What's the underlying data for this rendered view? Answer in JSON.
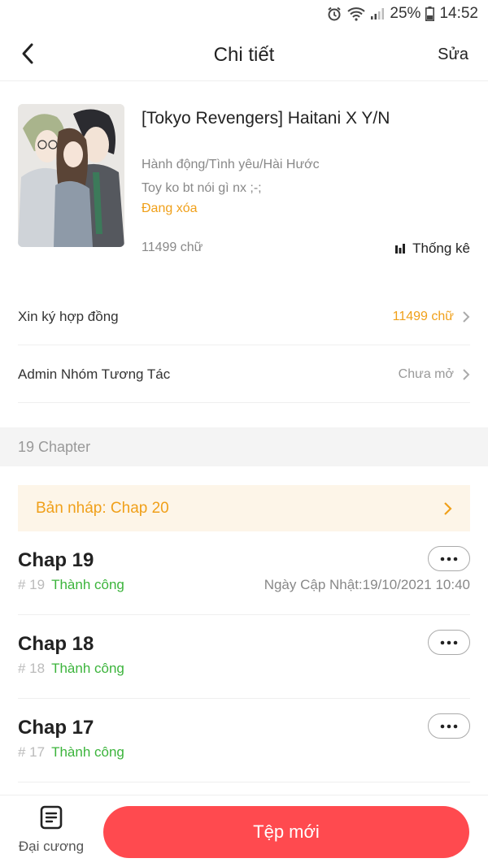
{
  "status_bar": {
    "battery": "25%",
    "time": "14:52"
  },
  "header": {
    "title": "Chi tiết",
    "edit_label": "Sửa"
  },
  "book": {
    "title": "[Tokyo Revengers] Haitani X Y/N",
    "genres": "Hành động/Tình yêu/Hài Hước",
    "description": "Toy ko bt nói gì nx ;-;",
    "status": "Đang xóa",
    "word_count": "11499 chữ",
    "stats_label": "Thống kê"
  },
  "rows": [
    {
      "label": "Xin ký hợp đồng",
      "value": "11499 chữ",
      "accent": true
    },
    {
      "label": "Admin Nhóm Tương Tác",
      "value": "Chưa mở",
      "accent": false
    }
  ],
  "chapter_section": {
    "title": "19 Chapter"
  },
  "draft": {
    "label": "Bản nháp: Chap 20"
  },
  "chapters": [
    {
      "title": "Chap 19",
      "num": "# 19",
      "status": "Thành công",
      "updated": "Ngày Cập Nhật:19/10/2021 10:40"
    },
    {
      "title": "Chap 18",
      "num": "# 18",
      "status": "Thành công",
      "updated": ""
    },
    {
      "title": "Chap 17",
      "num": "# 17",
      "status": "Thành công",
      "updated": ""
    }
  ],
  "bottom": {
    "outline_label": "Đại cương",
    "new_file_label": "Tệp mới"
  },
  "colors": {
    "accent_orange": "#f0a01a",
    "success_green": "#3cb43c",
    "primary_red": "#ff4a4f",
    "draft_bg": "#fdf5e8"
  }
}
